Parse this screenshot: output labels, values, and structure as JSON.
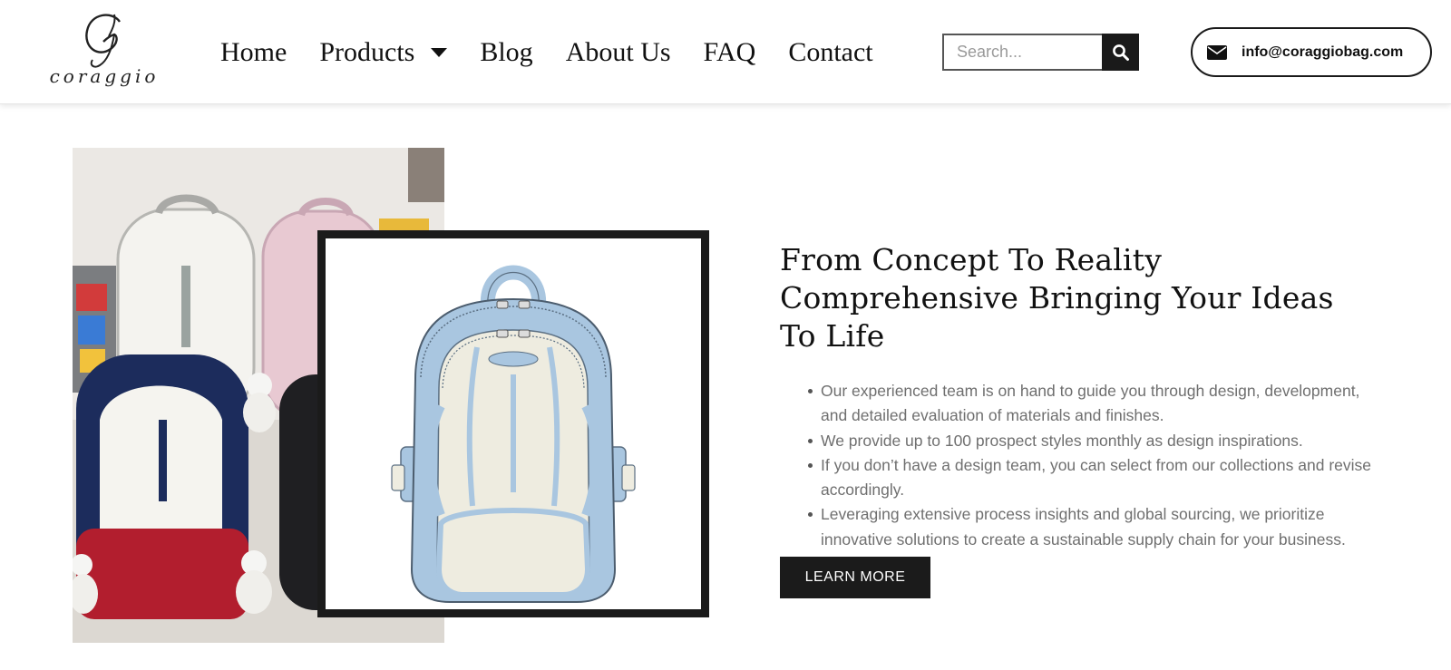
{
  "header": {
    "logo": {
      "monogram": "G",
      "wordmark": "coraggio"
    },
    "nav": [
      {
        "label": "Home"
      },
      {
        "label": "Products",
        "has_dropdown": true
      },
      {
        "label": "Blog"
      },
      {
        "label": "About Us"
      },
      {
        "label": "FAQ"
      },
      {
        "label": "Contact"
      }
    ],
    "search": {
      "placeholder": "Search...",
      "value": "",
      "button_icon": "search-icon"
    },
    "email": {
      "icon": "envelope-icon",
      "label": "info@coraggiobag.com"
    }
  },
  "hero": {
    "headline": "From Concept To Reality Comprehensive Bringing Your Ideas To Life",
    "bullets": [
      "Our experienced team is on hand to guide you through design, development, and detailed evaluation of materials and finishes.",
      "We provide up to 100 prospect styles monthly as design inspirations.",
      "If you don’t have a design team, you can select from our collections and revise accordingly.",
      "Leveraging extensive process insights and global sourcing, we prioritize innovative solutions to create a sustainable supply chain for your business."
    ],
    "cta_label": "LEARN MORE"
  },
  "colors": {
    "dark": "#1b1b1b",
    "body_text": "#6f6f6f",
    "sketch_blue": "#a9c6e0",
    "sketch_cream": "#eeece0"
  }
}
